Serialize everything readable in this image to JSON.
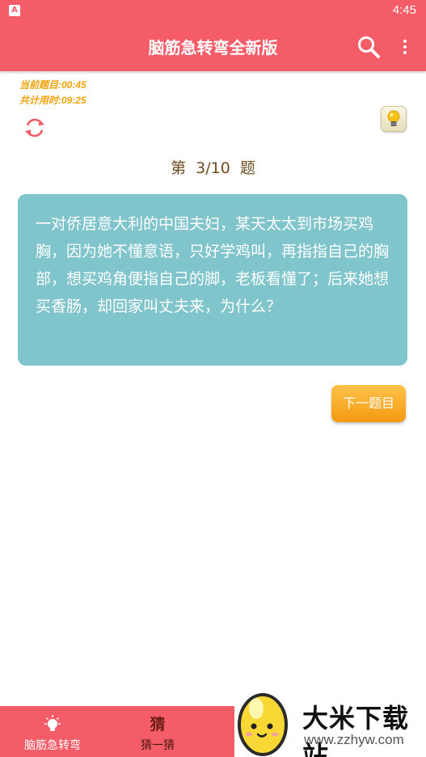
{
  "status_bar": {
    "time": "4:45",
    "app_icon": "A"
  },
  "app_bar": {
    "title": "脑筋急转弯全新版"
  },
  "timers": {
    "current": "当前题目:00:45",
    "total": "共计用时:09:25"
  },
  "question": {
    "number_label": "第  3/10  题",
    "text": "一对侨居意大利的中国夫妇，某天太太到市场买鸡胸，因为她不懂意语，只好学鸡叫，再指指自己的胸部，想买鸡角便指自己的脚，老板看懂了；后来她想买香肠，却回家叫丈夫来，为什么？"
  },
  "next_button": {
    "label": "下一题目"
  },
  "tab_bar": {
    "tabs": [
      {
        "label": "脑筋急转弯",
        "icon": "lightbulb-icon",
        "selected": false
      },
      {
        "label": "猜一猜",
        "icon": "guess-icon",
        "icon_text": "猜",
        "selected": true
      }
    ]
  },
  "watermark": {
    "name": "大米下载站",
    "url": "www.zzhyw.com"
  },
  "colors": {
    "primary": "#f45d68",
    "card": "#80c4cc",
    "accent_orange": "#f39a10",
    "timer_text": "#f2a30b"
  }
}
